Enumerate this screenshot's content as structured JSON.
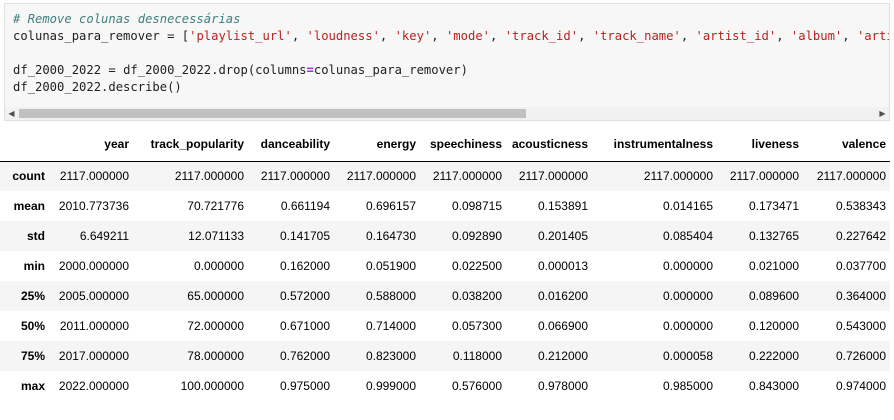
{
  "code": {
    "comment": "# Remove colunas desnecessárias",
    "line2_var": "colunas_para_remover",
    "line2_eq": " = [",
    "columns_to_remove": [
      "'playlist_url'",
      "'loudness'",
      "'key'",
      "'mode'",
      "'track_id'",
      "'track_name'",
      "'artist_id'",
      "'album'",
      "'artist_"
    ],
    "sep": ", ",
    "line4_a": "df_2000_2022",
    "line4_eq": " = ",
    "line4_b": "df_2000_2022.drop(columns",
    "line4_op": "=",
    "line4_c": "colunas_para_remover)",
    "line5": "df_2000_2022.describe()"
  },
  "scrollbar": {
    "left_arrow": "◀",
    "right_arrow": "▶"
  },
  "table": {
    "columns": [
      "year",
      "track_popularity",
      "danceability",
      "energy",
      "speechiness",
      "acousticness",
      "instrumentalness",
      "liveness",
      "valence"
    ],
    "rows": [
      {
        "label": "count",
        "values": [
          "2117.000000",
          "2117.000000",
          "2117.000000",
          "2117.000000",
          "2117.000000",
          "2117.000000",
          "2117.000000",
          "2117.000000",
          "2117.000000"
        ]
      },
      {
        "label": "mean",
        "values": [
          "2010.773736",
          "70.721776",
          "0.661194",
          "0.696157",
          "0.098715",
          "0.153891",
          "0.014165",
          "0.173471",
          "0.538343"
        ]
      },
      {
        "label": "std",
        "values": [
          "6.649211",
          "12.071133",
          "0.141705",
          "0.164730",
          "0.092890",
          "0.201405",
          "0.085404",
          "0.132765",
          "0.227642"
        ]
      },
      {
        "label": "min",
        "values": [
          "2000.000000",
          "0.000000",
          "0.162000",
          "0.051900",
          "0.022500",
          "0.000013",
          "0.000000",
          "0.021000",
          "0.037700"
        ]
      },
      {
        "label": "25%",
        "values": [
          "2005.000000",
          "65.000000",
          "0.572000",
          "0.588000",
          "0.038200",
          "0.016200",
          "0.000000",
          "0.089600",
          "0.364000"
        ]
      },
      {
        "label": "50%",
        "values": [
          "2011.000000",
          "72.000000",
          "0.671000",
          "0.714000",
          "0.057300",
          "0.066900",
          "0.000000",
          "0.120000",
          "0.543000"
        ]
      },
      {
        "label": "75%",
        "values": [
          "2017.000000",
          "78.000000",
          "0.762000",
          "0.823000",
          "0.118000",
          "0.212000",
          "0.000058",
          "0.222000",
          "0.726000"
        ]
      },
      {
        "label": "max",
        "values": [
          "2022.000000",
          "100.000000",
          "0.975000",
          "0.999000",
          "0.576000",
          "0.978000",
          "0.985000",
          "0.843000",
          "0.974000"
        ]
      }
    ]
  }
}
